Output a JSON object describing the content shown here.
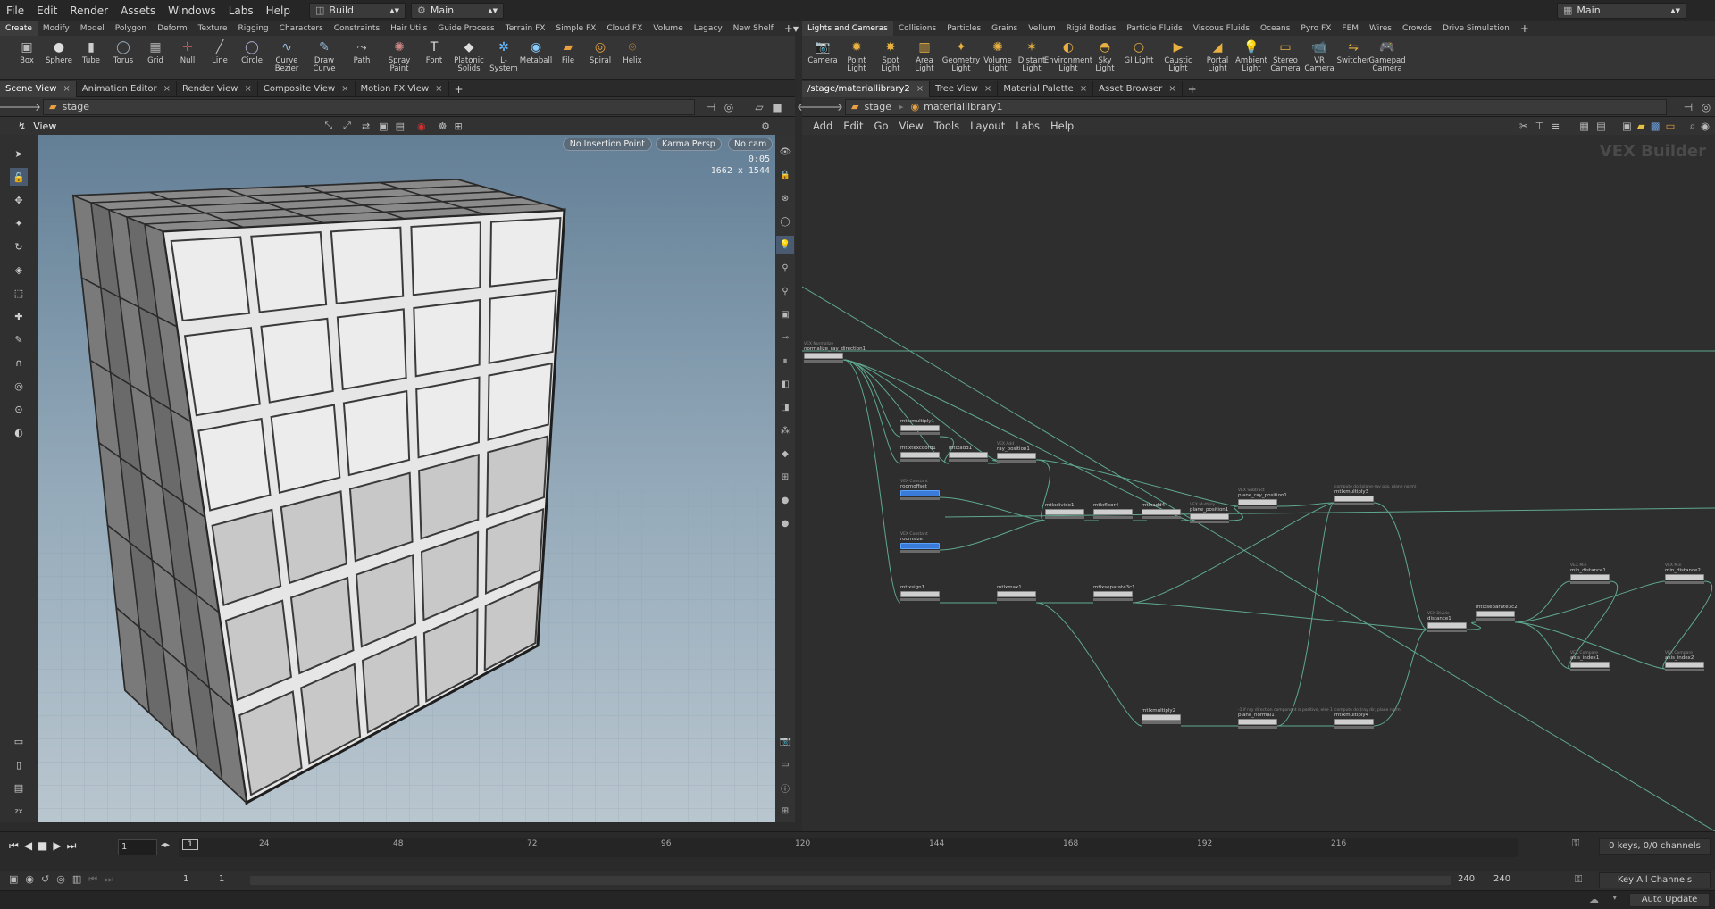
{
  "menu": [
    "File",
    "Edit",
    "Render",
    "Assets",
    "Windows",
    "Labs",
    "Help"
  ],
  "desktop": "Build",
  "context": "Main",
  "right_desktop": "Main",
  "left_shelf_tabs": [
    "Create",
    "Modify",
    "Model",
    "Polygon",
    "Deform",
    "Texture",
    "Rigging",
    "Characters",
    "Constraints",
    "Hair Utils",
    "Guide Process",
    "Terrain FX",
    "Simple FX",
    "Cloud FX",
    "Volume",
    "Legacy",
    "New Shelf"
  ],
  "left_tools": [
    "Box",
    "Sphere",
    "Tube",
    "Torus",
    "Grid",
    "Null",
    "Line",
    "Circle",
    "Curve Bezier",
    "Draw Curve",
    "Path",
    "Spray Paint",
    "Font",
    "Platonic Solids",
    "L-System",
    "Metaball",
    "File",
    "Spiral",
    "Helix"
  ],
  "right_shelf_tabs": [
    "Lights and Cameras",
    "Collisions",
    "Particles",
    "Grains",
    "Vellum",
    "Rigid Bodies",
    "Particle Fluids",
    "Viscous Fluids",
    "Oceans",
    "Pyro FX",
    "FEM",
    "Wires",
    "Crowds",
    "Drive Simulation"
  ],
  "right_tools": [
    "Camera",
    "Point Light",
    "Spot Light",
    "Area Light",
    "Geometry Light",
    "Volume Light",
    "Distant Light",
    "Environment Light",
    "Sky Light",
    "GI Light",
    "Caustic Light",
    "Portal Light",
    "Ambient Light",
    "Stereo Camera",
    "VR Camera",
    "Switcher",
    "Gamepad Camera"
  ],
  "left_pane_tabs": [
    "Scene View",
    "Animation Editor",
    "Render View",
    "Composite View",
    "Motion FX View"
  ],
  "left_path": "stage",
  "viewport": {
    "title": "View",
    "insertion": "No Insertion Point",
    "renderer": "Karma Persp",
    "camera": "No cam",
    "time": "0:05",
    "resolution": "1662 x 1544"
  },
  "right_pane_tabs": [
    "/stage/materiallibrary2",
    "Tree View",
    "Material Palette",
    "Asset Browser"
  ],
  "right_path": {
    "root": "stage",
    "node": "materiallibrary1"
  },
  "network_menu": [
    "Add",
    "Edit",
    "Go",
    "View",
    "Tools",
    "Layout",
    "Labs",
    "Help"
  ],
  "network_label": "VEX Builder",
  "nodes": [
    {
      "label": "normalize_ray_direction1",
      "tag": "VEX Normalize"
    },
    {
      "label": "mtlxmultiply1",
      "tag": ""
    },
    {
      "label": "mtlxtexcoord1",
      "tag": ""
    },
    {
      "label": "mtlxadd1",
      "tag": ""
    },
    {
      "label": "ray_position1",
      "tag": "VEX Add"
    },
    {
      "label": "roomoffset",
      "tag": "VEX Constant"
    },
    {
      "label": "roomsize",
      "tag": "VEX Constant"
    },
    {
      "label": "mtlxdivide1",
      "tag": ""
    },
    {
      "label": "mtlxfloor4",
      "tag": ""
    },
    {
      "label": "mtlxadd4",
      "tag": ""
    },
    {
      "label": "plane_position1",
      "tag": "VEX Multiply"
    },
    {
      "label": "plane_ray_position1",
      "tag": "VEX Subtract"
    },
    {
      "label": "mtlxmultiply3",
      "tag": "compute dot(plane-ray pos, plane norm)"
    },
    {
      "label": "mtlxsign1",
      "tag": ""
    },
    {
      "label": "mtlxmax1",
      "tag": ""
    },
    {
      "label": "mtlxseparate3c1",
      "tag": ""
    },
    {
      "label": "distance1",
      "tag": "VEX Divide"
    },
    {
      "label": "mtlxseparate3c2",
      "tag": ""
    },
    {
      "label": "min_distance1",
      "tag": "VEX Min"
    },
    {
      "label": "min_distance2",
      "tag": "VEX Min"
    },
    {
      "label": "axis_index1",
      "tag": "VEX Compare"
    },
    {
      "label": "axis_index2",
      "tag": "VEX Compare"
    },
    {
      "label": "mtlxmultiply2",
      "tag": ""
    },
    {
      "label": "plane_normal1",
      "tag": "-1 if ray direction component is positive, else 1"
    },
    {
      "label": "mtlxmultiply4",
      "tag": "compute dot(ray dir, plane norm)"
    }
  ],
  "timeline": {
    "ticks": [
      "24",
      "48",
      "72",
      "96",
      "120",
      "144",
      "168",
      "192",
      "216"
    ],
    "frame": "1",
    "start": "1",
    "start2": "1",
    "end": "240",
    "end2": "240",
    "keys": "0 keys, 0/0 channels",
    "key_all": "Key All Channels"
  },
  "status": {
    "auto_update": "Auto Update"
  }
}
